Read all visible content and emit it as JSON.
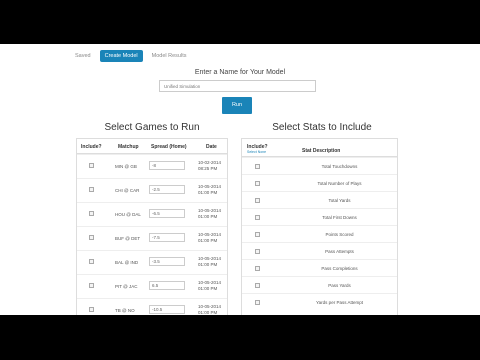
{
  "tabs": [
    {
      "label": "Saved"
    },
    {
      "label": "Create Model"
    },
    {
      "label": "Model Results"
    }
  ],
  "model_name": {
    "label": "Enter a Name for Your Model",
    "value": "Unified Simulation"
  },
  "run_label": "Run",
  "games": {
    "title": "Select Games to Run",
    "headers": {
      "include": "Include?",
      "matchup": "Matchup",
      "spread": "Spread (Home)",
      "date": "Date"
    },
    "rows": [
      {
        "matchup": "MIN @ GB",
        "spread": "-8",
        "date": "10-02-2014",
        "time": "08:25 PM"
      },
      {
        "matchup": "CHI @ CAR",
        "spread": "-2.5",
        "date": "10-05-2014",
        "time": "01:00 PM"
      },
      {
        "matchup": "HOU @ DAL",
        "spread": "-6.5",
        "date": "10-05-2014",
        "time": "01:00 PM"
      },
      {
        "matchup": "BUF @ DET",
        "spread": "-7.5",
        "date": "10-05-2014",
        "time": "01:00 PM"
      },
      {
        "matchup": "BAL @ IND",
        "spread": "-3.5",
        "date": "10-05-2014",
        "time": "01:00 PM"
      },
      {
        "matchup": "PIT @ JAC",
        "spread": "6.5",
        "date": "10-05-2014",
        "time": "01:00 PM"
      },
      {
        "matchup": "TB @ NO",
        "spread": "-10.5",
        "date": "10-05-2014",
        "time": "01:00 PM"
      }
    ]
  },
  "stats": {
    "title": "Select Stats to Include",
    "headers": {
      "include": "Include?",
      "select_none": "Select None",
      "description": "Stat Description"
    },
    "rows": [
      "Total Touchdowns",
      "Total Number of Plays",
      "Total Yards",
      "Total First Downs",
      "Points Scored",
      "Pass Attempts",
      "Pass Completions",
      "Pass Yards",
      "Yards per Pass Attempt"
    ]
  }
}
